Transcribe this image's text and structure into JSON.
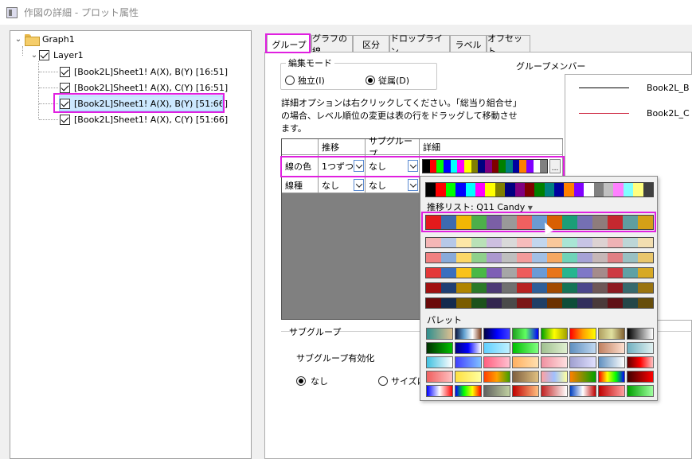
{
  "window": {
    "title": "作図の詳細 - プロット属性"
  },
  "tree": {
    "graph": "Graph1",
    "layer": "Layer1",
    "plots": [
      "[Book2L]Sheet1! A(X), B(Y) [16:51]",
      "[Book2L]Sheet1! A(X), C(Y) [16:51]",
      "[Book2L]Sheet1! A(X), B(Y) [51:66]",
      "[Book2L]Sheet1! A(X), C(Y) [51:66]"
    ]
  },
  "tabs": [
    "グループ",
    "グラフの線",
    "区分",
    "ドロップライン",
    "ラベル",
    "オフセット"
  ],
  "edit_mode": {
    "legend": "編集モード",
    "independent": "独立(I)",
    "dependent": "従属(D)"
  },
  "note": "詳細オプションは右クリックしてください。「総当り組合せ」の場合、レベル順位の変更は表の行をドラッグして移動させます。",
  "group_members": {
    "label": "グループメンバー",
    "items": [
      {
        "name": "Book2L_B",
        "color": "#000000"
      },
      {
        "name": "Book2L_C",
        "color": "#cc1f3a"
      }
    ]
  },
  "table": {
    "headers": [
      "推移",
      "サブグループ",
      "詳細"
    ],
    "rows": [
      {
        "name": "線の色",
        "increment": "1つずつ",
        "subgroup": "なし"
      },
      {
        "name": "線種",
        "increment": "なし",
        "subgroup": "なし"
      }
    ],
    "more_button": "..."
  },
  "popup": {
    "increment_list_label": "推移リスト: Q11 Candy",
    "palette_label": "パレット"
  },
  "subgroup": {
    "legend": "サブグループ",
    "enable_label": "サブグループ有効化",
    "option_none": "なし",
    "option_size": "サイズに"
  },
  "colors": {
    "highlight": "#e020e0",
    "selection": "#cce8ff"
  }
}
